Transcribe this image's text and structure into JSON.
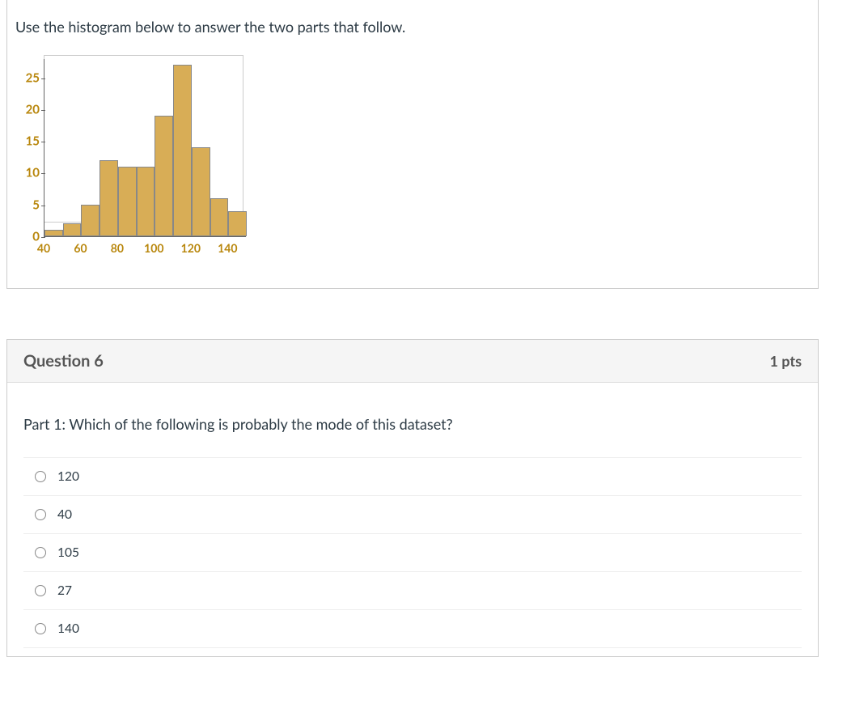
{
  "instruction": "Use the histogram below to answer the two parts that follow.",
  "chart_data": {
    "type": "bar",
    "categories": [
      "40",
      "50",
      "60",
      "70",
      "80",
      "90",
      "100",
      "110",
      "120",
      "130",
      "140"
    ],
    "values": [
      1,
      2,
      5,
      12,
      11,
      11,
      19,
      27,
      14,
      6,
      4
    ],
    "xlabel": "",
    "ylabel": "",
    "ylim": [
      0,
      28
    ],
    "yticks": [
      0,
      5,
      10,
      15,
      20,
      25
    ],
    "xticks": [
      "40",
      "60",
      "80",
      "100",
      "120",
      "140"
    ]
  },
  "question": {
    "title": "Question 6",
    "points": "1 pts",
    "text": "Part 1: Which of the following is probably the mode of this dataset?",
    "options": [
      "120",
      "40",
      "105",
      "27",
      "140"
    ]
  }
}
